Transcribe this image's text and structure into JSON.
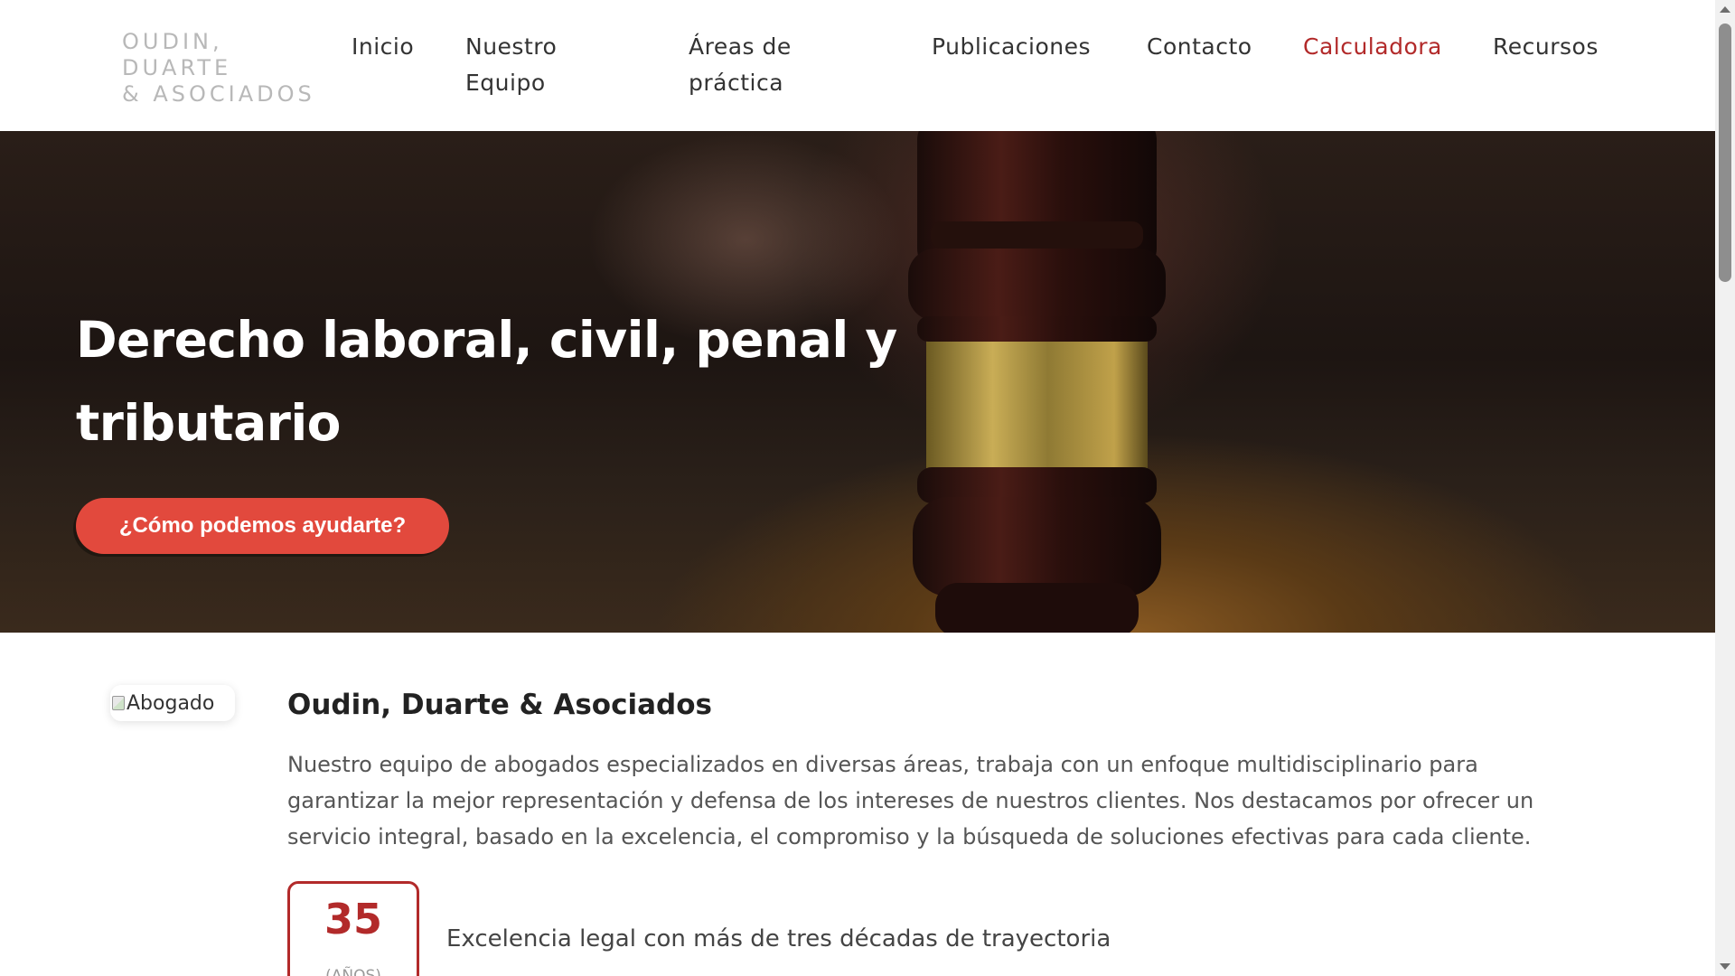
{
  "logo": {
    "line1": "OUDIN,",
    "line2": "DUARTE",
    "line3": "& ASOCIADOS"
  },
  "nav": {
    "items": [
      {
        "label_line1": "Inicio",
        "label_line2": ""
      },
      {
        "label_line1": "Nuestro",
        "label_line2": "Equipo"
      },
      {
        "label_line1": "Áreas de",
        "label_line2": "práctica"
      },
      {
        "label_line1": "Publicaciones",
        "label_line2": ""
      },
      {
        "label_line1": "Contacto",
        "label_line2": ""
      },
      {
        "label_line1": "Calculadora",
        "label_line2": ""
      },
      {
        "label_line1": "Recursos",
        "label_line2": ""
      }
    ],
    "active": "Calculadora",
    "active_color": "#b22a2a"
  },
  "hero": {
    "title_line1": "Derecho laboral, civil, penal y",
    "title_line2": "tributario",
    "cta_label": "¿Cómo podemos ayudarte?",
    "cta_color": "#e2493d"
  },
  "about": {
    "image_alt": "Abogado",
    "title": "Oudin, Duarte & Asociados",
    "text_line1": "Nuestro equipo de abogados especializados en diversas áreas, trabaja con un enfoque multidisciplinario para",
    "text_line2": "garantizar la mejor representación y defensa de los intereses de nuestros clientes. Nos destacamos por ofrecer un",
    "text_line3": "servicio integral, basado en la excelencia, el compromiso y la búsqueda de soluciones efectivas para cada cliente."
  },
  "stat": {
    "number": "35",
    "unit": "(AÑOS)",
    "text": "Excelencia legal con más de tres décadas de trayectoria",
    "accent": "#b22a2a"
  }
}
